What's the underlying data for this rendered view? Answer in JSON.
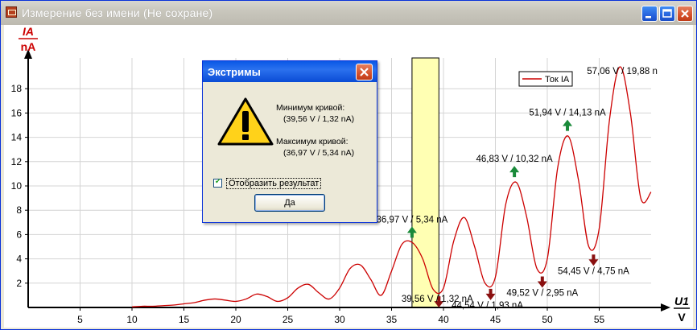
{
  "window": {
    "title": "Измерение без имени (Не сохране)",
    "icons": [
      "app-icon",
      "minimize-icon",
      "maximize-icon",
      "close-icon"
    ]
  },
  "chart_data": {
    "type": "line",
    "ylabel_top": "IA",
    "ylabel_bottom": "nA",
    "xlabel_top": "U1",
    "xlabel_bottom": "V",
    "xlim": [
      0,
      60
    ],
    "ylim": [
      0,
      20
    ],
    "x_ticks": [
      5,
      10,
      15,
      20,
      25,
      30,
      35,
      40,
      45,
      50,
      55
    ],
    "y_ticks": [
      2,
      4,
      6,
      8,
      10,
      12,
      14,
      16,
      18
    ],
    "grid": true,
    "legend": {
      "placement": "top-right",
      "entries": [
        "Ток IA"
      ]
    },
    "series": [
      {
        "name": "Ток IA",
        "color": "#cc0000",
        "x": [
          10,
          11,
          12,
          13,
          14,
          15,
          16,
          17,
          18,
          19,
          20,
          21,
          22,
          23,
          24,
          25,
          26,
          27,
          28,
          29,
          30,
          31,
          32,
          33,
          34,
          35,
          36,
          37,
          38,
          39,
          40,
          41,
          42,
          43,
          44,
          45,
          46,
          47,
          48,
          49,
          50,
          51,
          52,
          53,
          54,
          55,
          56,
          57,
          58,
          59,
          60
        ],
        "y": [
          0.05,
          0.1,
          0.1,
          0.15,
          0.2,
          0.3,
          0.4,
          0.6,
          0.7,
          0.6,
          0.5,
          0.7,
          1.1,
          0.9,
          0.5,
          0.8,
          1.6,
          1.9,
          1.2,
          0.7,
          1.6,
          3.2,
          3.5,
          2.3,
          1.0,
          3.0,
          5.2,
          5.34,
          4.0,
          1.5,
          1.6,
          5.5,
          7.4,
          5.0,
          2.0,
          2.5,
          8.5,
          10.3,
          7.5,
          3.2,
          4.0,
          11.5,
          14.1,
          10.5,
          5.0,
          6.5,
          15.5,
          19.8,
          16.0,
          9.0,
          9.5
        ]
      }
    ],
    "highlight_band": {
      "x": [
        36.97,
        39.56
      ]
    },
    "annotations": [
      {
        "text": "36,97 V / 5,34 nA",
        "x": 36.97,
        "y": 5.34,
        "arrow": "up"
      },
      {
        "text": "39,56 V / 1,32 nA",
        "x": 39.56,
        "y": 1.32,
        "arrow": "down"
      },
      {
        "text": "44,54 V / 1,93 nA",
        "x": 44.54,
        "y": 1.93,
        "arrow": "down"
      },
      {
        "text": "46,83 V / 10,32 nA",
        "x": 46.83,
        "y": 10.32,
        "arrow": "up"
      },
      {
        "text": "49,52 V / 2,95 nA",
        "x": 49.52,
        "y": 2.95,
        "arrow": "down"
      },
      {
        "text": "51,94 V / 14,13 nA",
        "x": 51.94,
        "y": 14.13,
        "arrow": "up"
      },
      {
        "text": "54,45 V / 4,75 nA",
        "x": 54.45,
        "y": 4.75,
        "arrow": "down"
      },
      {
        "text": "57,06 V / 19,88 n",
        "x": 57.06,
        "y": 19.88,
        "arrow": "none"
      }
    ],
    "colors": {
      "up_arrow": "#1a8a3a",
      "down_arrow": "#8a1010",
      "band": "#ffffb3",
      "axis_label": "#cc0000"
    }
  },
  "dialog": {
    "title": "Экстримы",
    "icon": "warning-icon",
    "min_label": "Минимум кривой:",
    "min_value": "(39,56 V / 1,32 nA)",
    "max_label": "Максимум кривой:",
    "max_value": "(36,97 V / 5,34 nA)",
    "checkbox_label": "Отобразить результат",
    "checkbox_checked": true,
    "ok_label": "Да"
  }
}
